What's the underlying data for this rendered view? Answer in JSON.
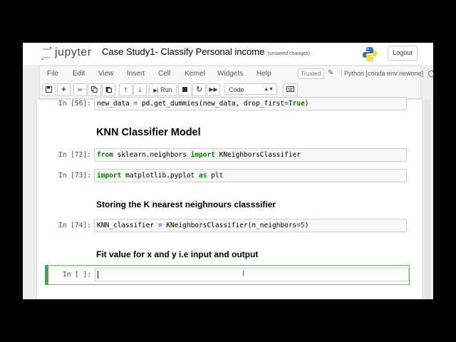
{
  "header": {
    "logo_text": "jupyter",
    "notebook_title": "Case Study1- Classify Personal income",
    "save_status": "(unsaved changes)",
    "logout_label": "Logout"
  },
  "menu": {
    "items": [
      "File",
      "Edit",
      "View",
      "Insert",
      "Cell",
      "Kernel",
      "Widgets",
      "Help"
    ],
    "trusted_label": "Trusted",
    "kernel_name": "Python [conda env:newone]"
  },
  "toolbar": {
    "run_label": "Run",
    "cell_type": "Code"
  },
  "cells": [
    {
      "prompt": "In [56]:",
      "code": [
        [
          "t",
          "new_data "
        ],
        [
          "op",
          "="
        ],
        [
          "t",
          " pd.get_dummies(new_data, drop_first"
        ],
        [
          "op",
          "="
        ],
        [
          "kw",
          "True"
        ],
        [
          "t",
          ")"
        ]
      ]
    },
    {
      "heading": "KNN Classifier Model"
    },
    {
      "prompt": "In [72]:",
      "code": [
        [
          "kw",
          "from"
        ],
        [
          "t",
          " sklearn.neighbors "
        ],
        [
          "kw",
          "import"
        ],
        [
          "t",
          " KNeighborsClassifier"
        ]
      ]
    },
    {
      "prompt": "In [73]:",
      "code": [
        [
          "kw",
          "import"
        ],
        [
          "t",
          " matplotlib.pyplot "
        ],
        [
          "kw",
          "as"
        ],
        [
          "t",
          " plt"
        ]
      ]
    },
    {
      "subheading": "Storing the K nearest neighnours classsifier"
    },
    {
      "prompt": "In [74]:",
      "code": [
        [
          "t",
          "KNN_classifier "
        ],
        [
          "op",
          "="
        ],
        [
          "t",
          " KNeighborsClassifier(n_neighbors"
        ],
        [
          "op",
          "="
        ],
        [
          "num",
          "5"
        ],
        [
          "t",
          ")"
        ]
      ]
    },
    {
      "subheading": "Fit value for x and y i.e input and output"
    },
    {
      "prompt": "In [ ]:",
      "code": []
    }
  ],
  "colors": {
    "prompt": "#303f9f",
    "keyword": "#008000",
    "operator": "#aa22ff",
    "selected_border": "#42a548",
    "jupyter_orange": "#f37726"
  }
}
